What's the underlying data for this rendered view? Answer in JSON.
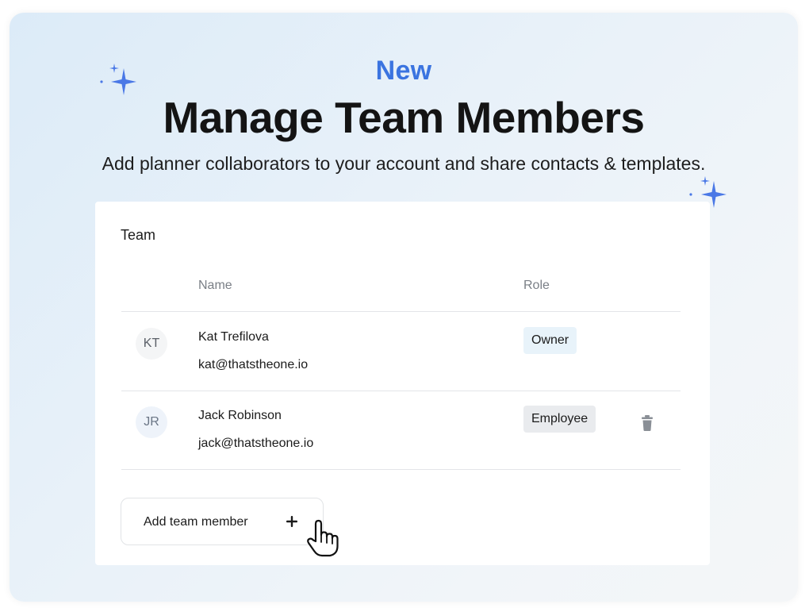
{
  "hero": {
    "badge": "New",
    "title": "Manage Team Members",
    "subtitle": "Add planner collaborators to your account and share contacts & templates."
  },
  "team": {
    "title": "Team",
    "columns": {
      "name": "Name",
      "role": "Role"
    },
    "members": [
      {
        "initials": "KT",
        "name": "Kat Trefilova",
        "email": "kat@thatstheone.io",
        "role": "Owner"
      },
      {
        "initials": "JR",
        "name": "Jack Robinson",
        "email": "jack@thatstheone.io",
        "role": "Employee"
      }
    ],
    "add_button_label": "Add team member"
  },
  "icons": {
    "sparkle": "sparkle-icon",
    "delete": "trash-icon",
    "add": "plus-icon",
    "pointer": "hand-pointer-icon"
  },
  "colors": {
    "accent": "#3b74e0",
    "sparkle": "#4a78e6",
    "owner_pill_bg": "#e8f3fa",
    "employee_pill_bg": "#e9ebee",
    "kt_avatar_bg": "#f4f5f6",
    "jr_avatar_bg": "#eef3fa"
  }
}
